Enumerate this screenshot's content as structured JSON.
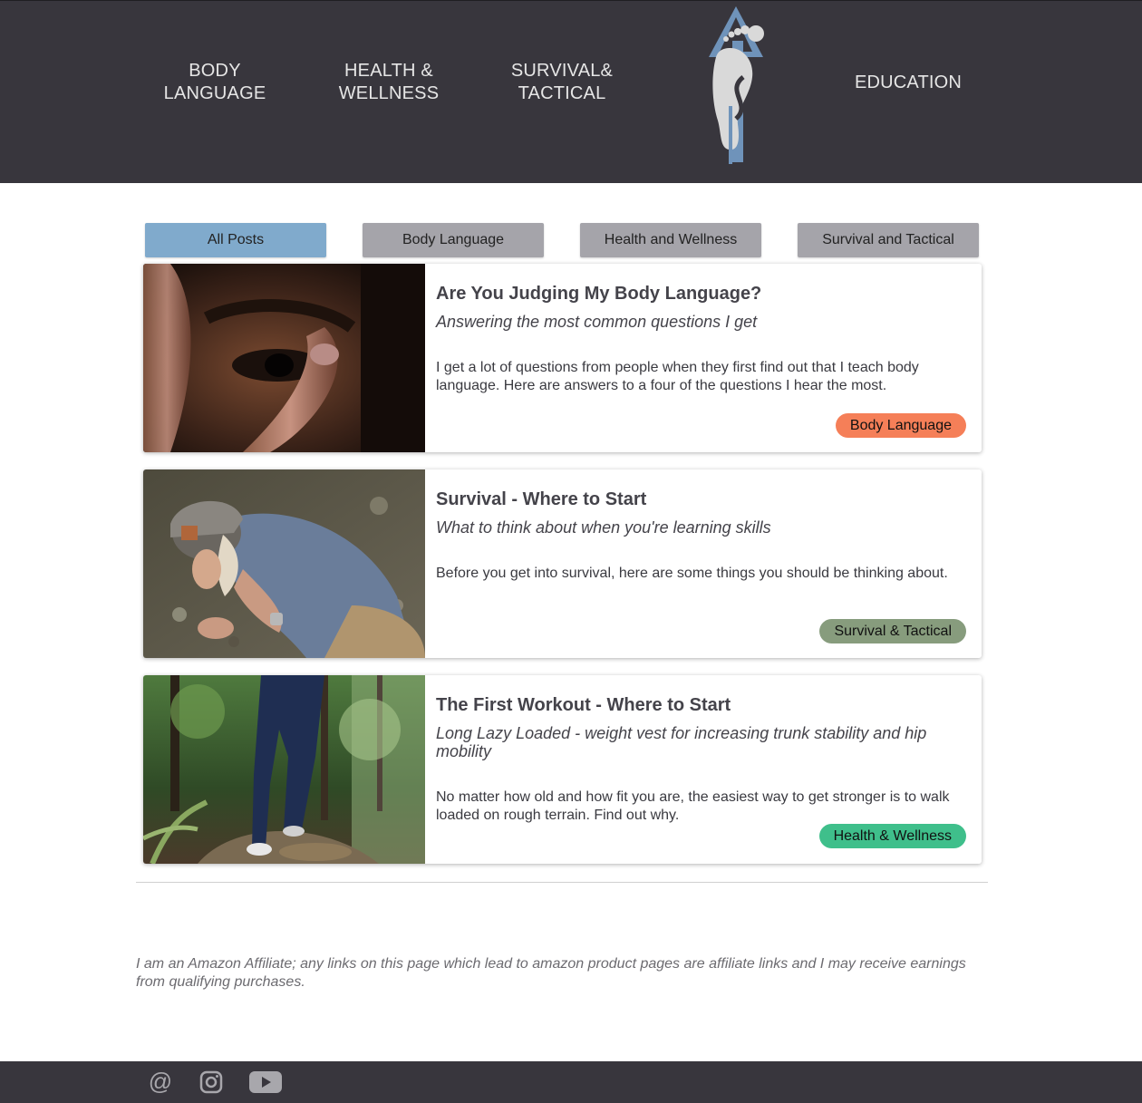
{
  "nav": {
    "items": [
      {
        "label": "BODY\nLANGUAGE"
      },
      {
        "label": "HEALTH &\nWELLNESS"
      },
      {
        "label": "SURVIVAL&\nTACTICAL"
      },
      {
        "label": "EDUCATION"
      }
    ],
    "logo_icon": "footprint-logo-icon"
  },
  "filters": [
    {
      "label": "All Posts",
      "active": true
    },
    {
      "label": "Body Language",
      "active": false
    },
    {
      "label": "Health and Wellness",
      "active": false
    },
    {
      "label": "Survival and Tactical",
      "active": false
    }
  ],
  "posts": [
    {
      "title": "Are You Judging My Body Language?",
      "subtitle": "Answering the most common questions I get",
      "excerpt": "I get a lot of questions from people when they first find out that I teach body language. Here are answers to a four of the questions I hear the most.",
      "tag": "Body Language",
      "tag_color": "#f57f58",
      "image": "eye-closeup-photo"
    },
    {
      "title": "Survival - Where to Start",
      "subtitle": "What to think about when you're learning skills",
      "excerpt": "Before you get into survival, here are some things you should be thinking about.",
      "tag": "Survival & Tactical",
      "tag_color": "#879c7d",
      "image": "man-crouching-outdoors-photo"
    },
    {
      "title": "The First Workout - Where to Start",
      "subtitle": "Long Lazy Loaded - weight vest for increasing trunk stability and hip mobility",
      "excerpt": "No matter how old and how fit you are, the easiest way to get stronger is to walk loaded on rough terrain. Find out why.",
      "tag": "Health & Wellness",
      "tag_color": "#3fbf8b",
      "image": "walking-forest-trail-photo"
    }
  ],
  "affiliate_text": "I am an Amazon Affiliate; any links on this page which lead to amazon product pages are affiliate links and I may receive earnings from qualifying purchases.",
  "footer": {
    "social_icons": [
      "email-at-icon",
      "instagram-icon",
      "youtube-icon"
    ]
  },
  "colors": {
    "header_bg": "#38363d",
    "filter_active": "#80aacc",
    "filter_inactive": "#a5a4aa",
    "logo_blue": "#6f93ba"
  }
}
